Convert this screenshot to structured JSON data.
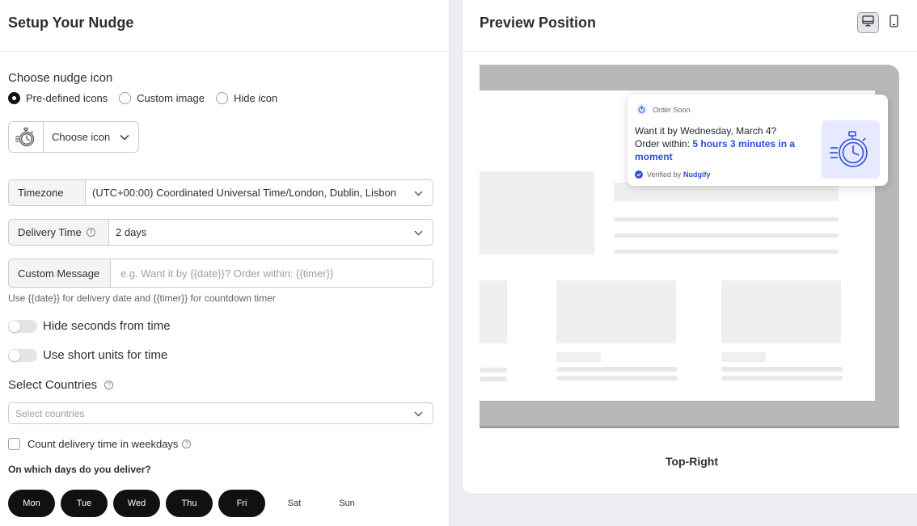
{
  "setup": {
    "title": "Setup Your Nudge",
    "icon_section_label": "Choose nudge icon",
    "icon_options": [
      {
        "label": "Pre-defined icons",
        "selected": true
      },
      {
        "label": "Custom image",
        "selected": false
      },
      {
        "label": "Hide icon",
        "selected": false
      }
    ],
    "choose_icon_label": "Choose icon",
    "timezone": {
      "label": "Timezone",
      "value": "(UTC+00:00) Coordinated Universal Time/London, Dublin, Lisbon"
    },
    "delivery_time": {
      "label": "Delivery Time",
      "value": "2 days"
    },
    "custom_message": {
      "label": "Custom Message",
      "placeholder": "e.g. Want it by {{date}}? Order within: {{timer}}",
      "value": ""
    },
    "help_text": "Use {{date}} for delivery date and {{timer}} for countdown timer",
    "toggles": [
      {
        "label": "Hide seconds from time",
        "on": false
      },
      {
        "label": "Use short units for time",
        "on": false
      }
    ],
    "countries": {
      "label": "Select Countries",
      "placeholder": "Select countries"
    },
    "weekdays_checkbox": {
      "label": "Count delivery time in weekdays",
      "checked": false
    },
    "days_label": "On which days do you deliver?",
    "days": [
      {
        "label": "Mon",
        "selected": true
      },
      {
        "label": "Tue",
        "selected": true
      },
      {
        "label": "Wed",
        "selected": true
      },
      {
        "label": "Thu",
        "selected": true
      },
      {
        "label": "Fri",
        "selected": true
      },
      {
        "label": "Sat",
        "selected": false
      },
      {
        "label": "Sun",
        "selected": false
      }
    ]
  },
  "preview": {
    "title": "Preview Position",
    "device_buttons": [
      {
        "name": "desktop-icon",
        "selected": true
      },
      {
        "name": "mobile-icon",
        "selected": false
      }
    ],
    "nudge": {
      "header": "Order Soon",
      "line1": "Want it by Wednesday, March 4?",
      "line2_prefix": "Order within: ",
      "timer": "5 hours 3 minutes in a moment",
      "verified_prefix": "Verified by",
      "verified_brand": "Nudgify"
    },
    "position_label": "Top-Right"
  },
  "colors": {
    "accent": "#2f4fd8",
    "nudge_icon_bg": "#e6e9ff",
    "selected_day_bg": "#111111",
    "page_bg": "#eceef1"
  }
}
